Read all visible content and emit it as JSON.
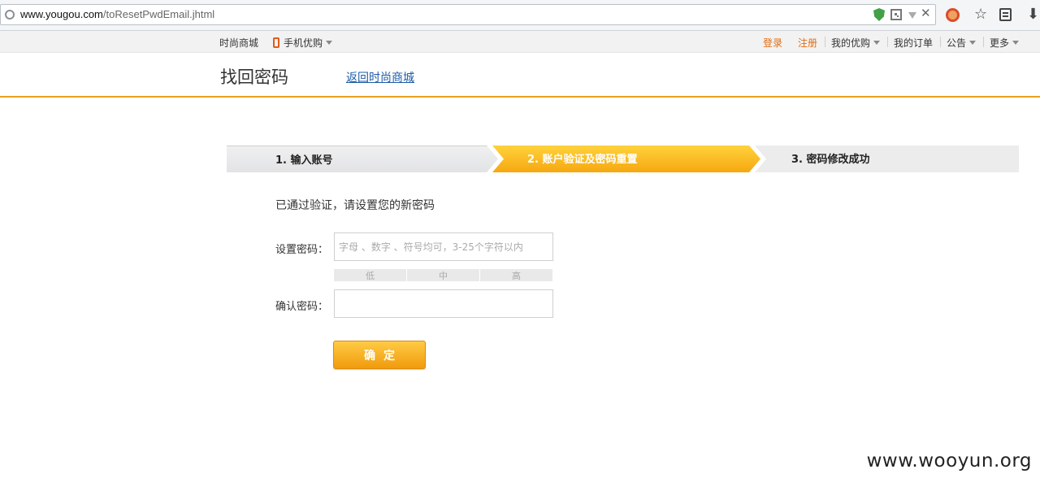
{
  "browser": {
    "url_domain": "www.yougou.com",
    "url_path": "/toResetPwdEmail.jhtml",
    "icons": [
      "globe-icon",
      "shield-icon",
      "qr-icon",
      "dropdown-icon",
      "close-icon",
      "adblock-icon",
      "star-icon",
      "reader-icon",
      "download-icon"
    ],
    "close_glyph": "✕",
    "star_glyph": "☆",
    "download_glyph": "⬇"
  },
  "topnav": {
    "shop": "时尚商城",
    "mobile": "手机优购",
    "login": "登录",
    "register": "注册",
    "my_yougou": "我的优购",
    "my_orders": "我的订单",
    "notice": "公告",
    "more": "更多"
  },
  "header": {
    "title": "找回密码",
    "back_link": "返回时尚商城"
  },
  "steps": [
    {
      "label": "1. 输入账号",
      "state": "done"
    },
    {
      "label": "2. 账户验证及密码重置",
      "state": "active"
    },
    {
      "label": "3. 密码修改成功",
      "state": "todo"
    }
  ],
  "form": {
    "verified_message": "已通过验证，请设置您的新密码",
    "password_label": "设置密码：",
    "password_placeholder": "字母 、数字 、符号均可，3-25个字符以内",
    "strength": [
      "低",
      "中",
      "高"
    ],
    "confirm_label": "确认密码：",
    "confirm_value": "",
    "submit_label": "确定"
  },
  "colors": {
    "accent": "#f6a810",
    "link": "#1f5ca8",
    "nav_highlight": "#e36b10"
  },
  "watermark": "www.wooyun.org"
}
